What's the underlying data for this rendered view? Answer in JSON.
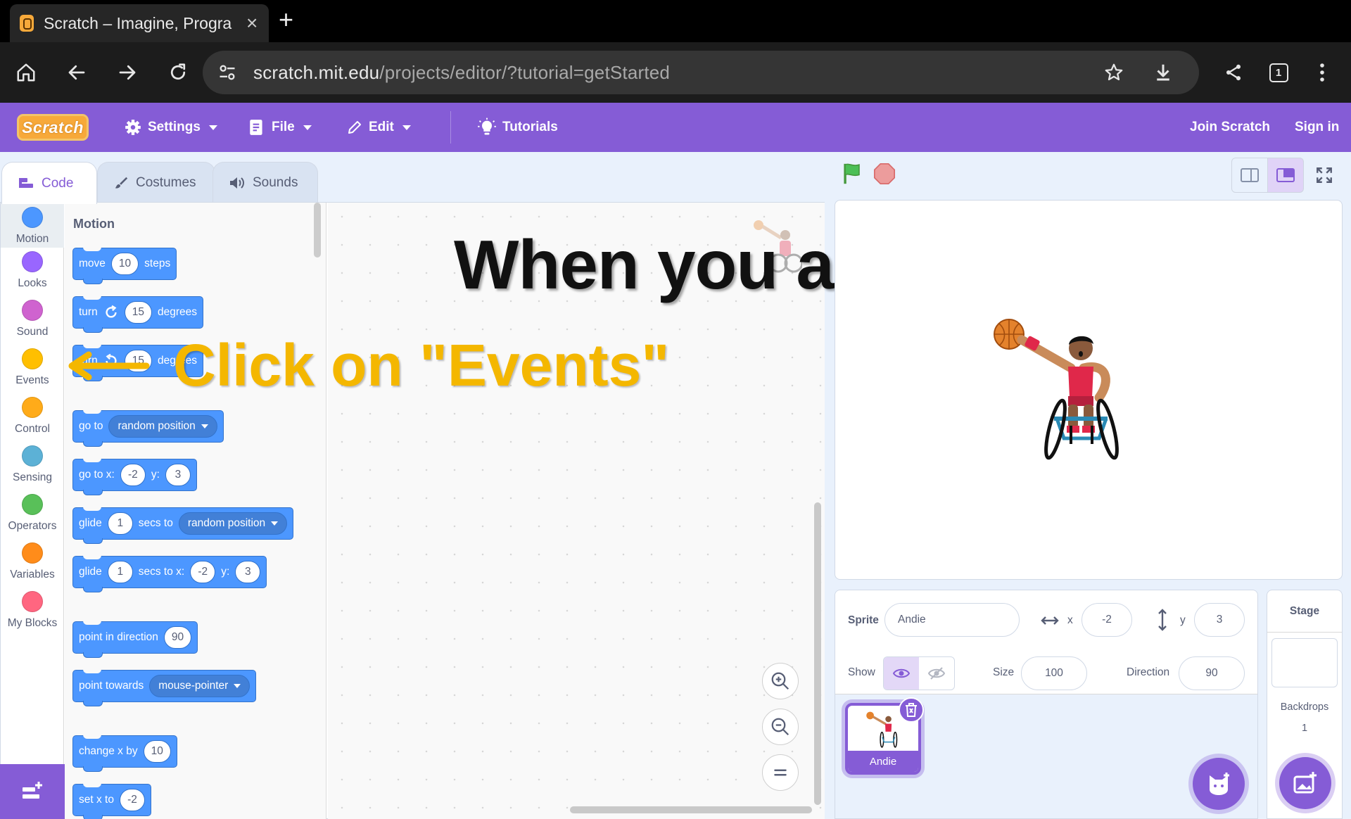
{
  "browser": {
    "tab_title": "Scratch – Imagine, Progra",
    "url_host": "scratch.mit.edu",
    "url_path": "/projects/editor/?tutorial=getStarted",
    "tab_count": "1"
  },
  "menubar": {
    "logo_text": "Scratch",
    "settings": "Settings",
    "file": "File",
    "edit": "Edit",
    "tutorials": "Tutorials",
    "join": "Join Scratch",
    "signin": "Sign in"
  },
  "editor_tabs": [
    "Code",
    "Costumes",
    "Sounds"
  ],
  "categories": [
    {
      "label": "Motion",
      "color": "#4c97ff"
    },
    {
      "label": "Looks",
      "color": "#9966ff"
    },
    {
      "label": "Sound",
      "color": "#cf63cf"
    },
    {
      "label": "Events",
      "color": "#ffbf00"
    },
    {
      "label": "Control",
      "color": "#ffab19"
    },
    {
      "label": "Sensing",
      "color": "#5cb1d6"
    },
    {
      "label": "Operators",
      "color": "#59c059"
    },
    {
      "label": "Variables",
      "color": "#ff8c1a"
    },
    {
      "label": "My Blocks",
      "color": "#ff6680"
    }
  ],
  "palette": {
    "title": "Motion",
    "move": {
      "a": "move",
      "v": "10",
      "b": "steps"
    },
    "turn_right": {
      "a": "turn",
      "v": "15",
      "b": "degrees"
    },
    "turn_left": {
      "a": "turn",
      "v": "15",
      "b": "degrees"
    },
    "goto": {
      "a": "go to",
      "dd": "random position"
    },
    "goto_xy": {
      "a": "go to x:",
      "x": "-2",
      "b": "y:",
      "y": "3"
    },
    "glide_to": {
      "a": "glide",
      "v": "1",
      "b": "secs to",
      "dd": "random position"
    },
    "glide_xy": {
      "a": "glide",
      "v": "1",
      "b": "secs to x:",
      "x": "-2",
      "c": "y:",
      "y": "3"
    },
    "point_dir": {
      "a": "point in direction",
      "v": "90"
    },
    "point_towards": {
      "a": "point towards",
      "dd": "mouse-pointer"
    },
    "change_x": {
      "a": "change x by",
      "v": "10"
    },
    "set_x": {
      "a": "set x to",
      "v": "-2"
    }
  },
  "overlay": {
    "done_text": "When you are done",
    "click_text": "Click on \"Events\"",
    "overlay_color": "#f4b700"
  },
  "sprite_info": {
    "sprite_label": "Sprite",
    "sprite_name": "Andie",
    "x_label": "x",
    "x_value": "-2",
    "y_label": "y",
    "y_value": "3",
    "show_label": "Show",
    "size_label": "Size",
    "size_value": "100",
    "direction_label": "Direction",
    "direction_value": "90",
    "thumb_label": "Andie"
  },
  "stage_selector": {
    "title": "Stage",
    "backdrops_label": "Backdrops",
    "backdrops_count": "1"
  },
  "colors": {
    "accent": "#855cd6",
    "motion": "#4c97ff"
  }
}
